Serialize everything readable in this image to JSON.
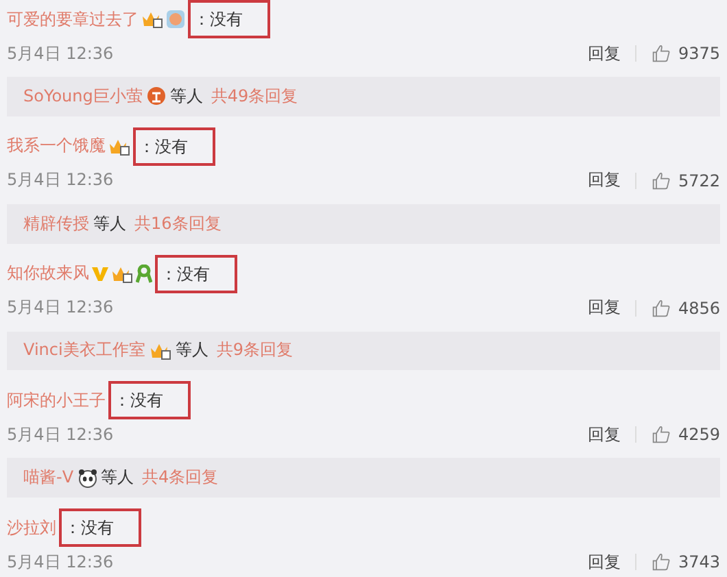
{
  "items": [
    {
      "kind": "comment",
      "author": "可爱的要章过去了",
      "badges": [
        {
          "kind": "vip"
        },
        {
          "kind": "round"
        }
      ],
      "text": "：没有",
      "highlighted": true,
      "time": "5月4日 12:36",
      "reply": "回复",
      "likes": "9375"
    },
    {
      "kind": "replies",
      "name": "SoYoung巨小萤",
      "badges": [
        {
          "kind": "red"
        }
      ],
      "others": "等人",
      "count": "共49条回复"
    },
    {
      "kind": "comment",
      "author": "我系一个饿魔",
      "badges": [
        {
          "kind": "vip"
        }
      ],
      "text": "：没有",
      "highlighted": true,
      "time": "5月4日 12:36",
      "reply": "回复",
      "likes": "5722"
    },
    {
      "kind": "replies",
      "name": "精辟传授",
      "others": "等人",
      "count": "共16条回复"
    },
    {
      "kind": "comment",
      "author": "知你故来风",
      "badges": [
        {
          "kind": "v"
        },
        {
          "kind": "vip"
        },
        {
          "kind": "ribbon"
        }
      ],
      "text": "：没有",
      "highlighted": true,
      "time": "5月4日 12:36",
      "reply": "回复",
      "likes": "4856"
    },
    {
      "kind": "replies",
      "name": "Vinci美衣工作室",
      "badges": [
        {
          "kind": "vip"
        }
      ],
      "others": "等人",
      "count": "共9条回复"
    },
    {
      "kind": "comment",
      "author": "阿宋的小王子",
      "text": "：没有",
      "highlighted": true,
      "time": "5月4日 12:36",
      "reply": "回复",
      "likes": "4259"
    },
    {
      "kind": "replies",
      "name": "喵酱-V",
      "badges": [
        {
          "kind": "panda"
        }
      ],
      "others": "等人",
      "count": "共4条回复"
    },
    {
      "kind": "comment",
      "author": "沙拉刘",
      "text": "：没有",
      "highlighted": true,
      "time": "5月4日 12:36",
      "reply": "回复",
      "likes": "3743"
    }
  ]
}
